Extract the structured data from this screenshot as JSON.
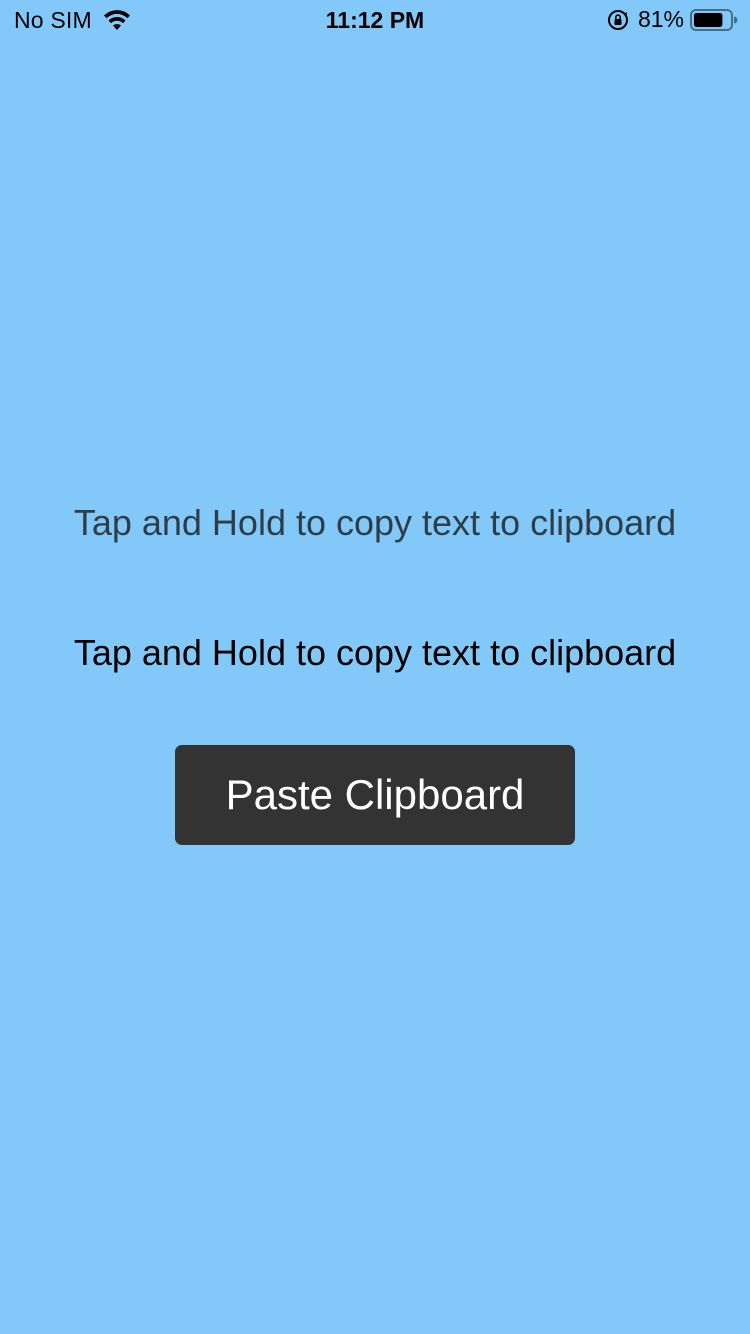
{
  "status_bar": {
    "carrier": "No SIM",
    "time": "11:12 PM",
    "battery_percent": "81%",
    "battery_level": 0.81,
    "icons": [
      "wifi-icon",
      "orientation-lock-icon",
      "battery-icon"
    ]
  },
  "main": {
    "label_one": "Tap and Hold to copy text to clipboard",
    "label_two": "Tap and Hold to copy text to clipboard",
    "paste_button_label": "Paste Clipboard"
  },
  "colors": {
    "background": "#82c9f9",
    "button_background": "#333333",
    "button_text": "#ffffff",
    "label_one_text": "#2e3e48",
    "label_two_text": "#000000"
  }
}
